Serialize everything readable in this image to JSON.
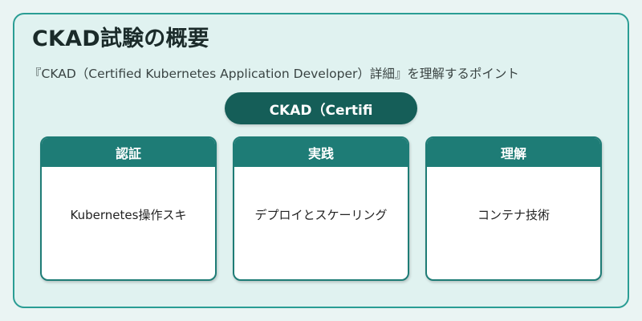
{
  "title": "CKAD試験の概要",
  "subtitle": "『CKAD（Certified Kubernetes Application Developer）詳細』を理解するポイント",
  "center": {
    "label": "CKAD（Certifi"
  },
  "cards": [
    {
      "heading": "認証",
      "body": "Kubernetes操作スキ"
    },
    {
      "heading": "実践",
      "body": "デプロイとスケーリング"
    },
    {
      "heading": "理解",
      "body": "コンテナ技術"
    }
  ],
  "colors": {
    "background": "#eaf4f3",
    "panel": "#e0f2f0",
    "border": "#2a9d94",
    "accent_dark": "#155e58",
    "card_header": "#1e7c76"
  }
}
